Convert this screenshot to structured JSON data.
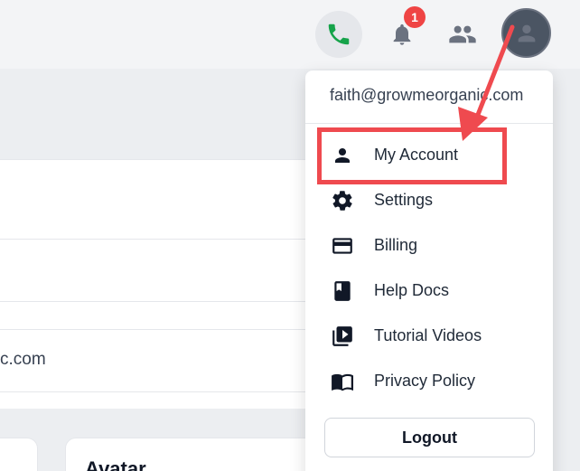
{
  "header": {
    "phone_icon": "phone-icon",
    "bell_icon": "bell-icon",
    "notification_count": "1",
    "team_icon": "team-icon",
    "avatar_icon": "user-avatar-icon"
  },
  "background": {
    "partial_email_text": "c.com",
    "card_title_partial": "Avatar"
  },
  "user_menu": {
    "email": "faith@growmeorganic.com",
    "items": [
      {
        "label": "My Account",
        "icon": "person-icon"
      },
      {
        "label": "Settings",
        "icon": "gear-icon"
      },
      {
        "label": "Billing",
        "icon": "credit-card-icon"
      },
      {
        "label": "Help Docs",
        "icon": "book-icon"
      },
      {
        "label": "Tutorial Videos",
        "icon": "video-library-icon"
      },
      {
        "label": "Privacy Policy",
        "icon": "open-book-icon"
      }
    ],
    "logout_label": "Logout"
  },
  "colors": {
    "annotation_red": "#ef4a4f",
    "badge_red": "#ef4444",
    "phone_green": "#16a34a",
    "icon_gray": "#6b7280",
    "avatar_bg": "#4b5563"
  }
}
